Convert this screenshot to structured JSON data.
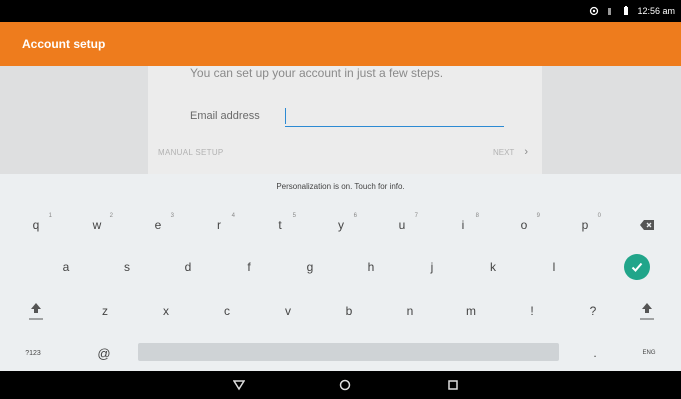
{
  "status_bar": {
    "time": "12:56 am",
    "icons": [
      "sync-icon",
      "signal-icon",
      "battery-icon"
    ]
  },
  "app_bar": {
    "title": "Account setup",
    "color": "#ee7c1d"
  },
  "setup_card": {
    "intro": "You can set up your account in just a few steps.",
    "email_label": "Email address",
    "email_value": "",
    "manual_setup": "MANUAL SETUP",
    "next": "NEXT"
  },
  "suggestion_strip": {
    "text": "Personalization is on. Touch for info."
  },
  "keyboard": {
    "row1": [
      {
        "k": "q",
        "s": "1"
      },
      {
        "k": "w",
        "s": "2"
      },
      {
        "k": "e",
        "s": "3"
      },
      {
        "k": "r",
        "s": "4"
      },
      {
        "k": "t",
        "s": "5"
      },
      {
        "k": "y",
        "s": "6"
      },
      {
        "k": "u",
        "s": "7"
      },
      {
        "k": "i",
        "s": "8"
      },
      {
        "k": "o",
        "s": "9"
      },
      {
        "k": "p",
        "s": "0"
      }
    ],
    "row2": [
      "a",
      "s",
      "d",
      "f",
      "g",
      "h",
      "j",
      "k",
      "l"
    ],
    "row3": [
      "z",
      "x",
      "c",
      "v",
      "b",
      "n",
      "m",
      "!",
      "?"
    ],
    "symbols_label": "?123",
    "at_label": "@",
    "period_label": ".",
    "lang_label": "ENG",
    "accent_color": "#21a58a"
  },
  "nav_bar": {
    "buttons": [
      "back-icon",
      "home-icon",
      "recents-icon"
    ]
  }
}
